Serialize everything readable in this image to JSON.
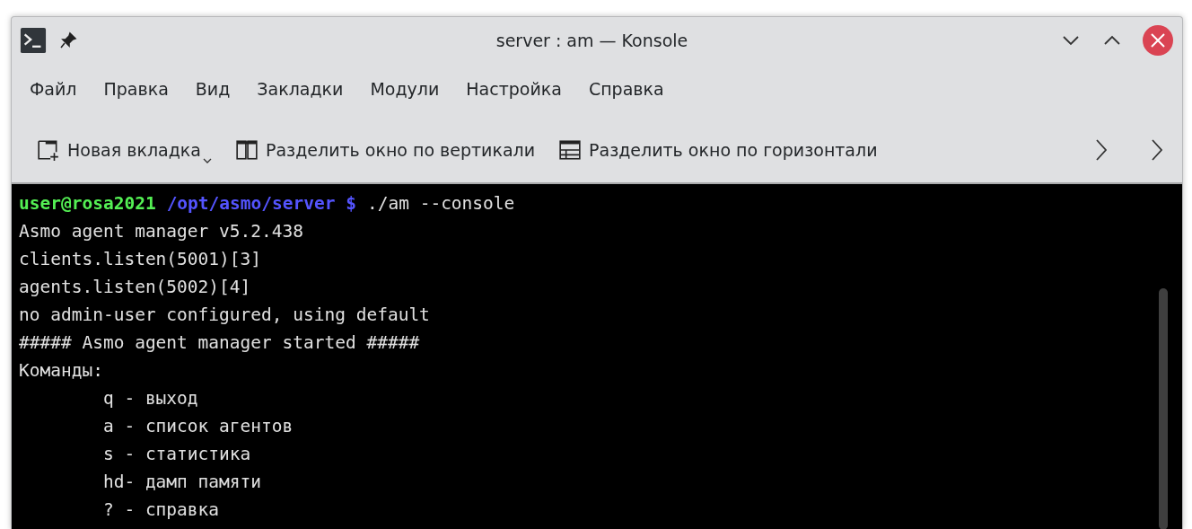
{
  "window": {
    "title": "server : am — Konsole"
  },
  "menu": [
    "Файл",
    "Правка",
    "Вид",
    "Закладки",
    "Модули",
    "Настройка",
    "Справка"
  ],
  "toolbar": [
    {
      "label": "Новая вкладка",
      "kind": "new-tab"
    },
    {
      "label": "Разделить окно по вертикали",
      "kind": "split-vertical"
    },
    {
      "label": "Разделить окно по горизонтали",
      "kind": "split-horizontal"
    }
  ],
  "terminal": {
    "prompt": [
      {
        "text": "user@rosa2021",
        "kind": "user"
      },
      {
        "text": "/opt/asmo/server $",
        "kind": "path"
      },
      {
        "text": "./am --console",
        "kind": "command"
      }
    ],
    "lines": [
      "Asmo agent manager v5.2.438",
      "clients.listen(5001)[3]",
      "agents.listen(5002)[4]",
      "no admin-user configured, using default",
      "##### Asmo agent manager started #####",
      "Команды:",
      "        q - выход",
      "        a - список агентов",
      "        s - статистика",
      "        hd- дамп памяти",
      "        ? - справка"
    ]
  }
}
